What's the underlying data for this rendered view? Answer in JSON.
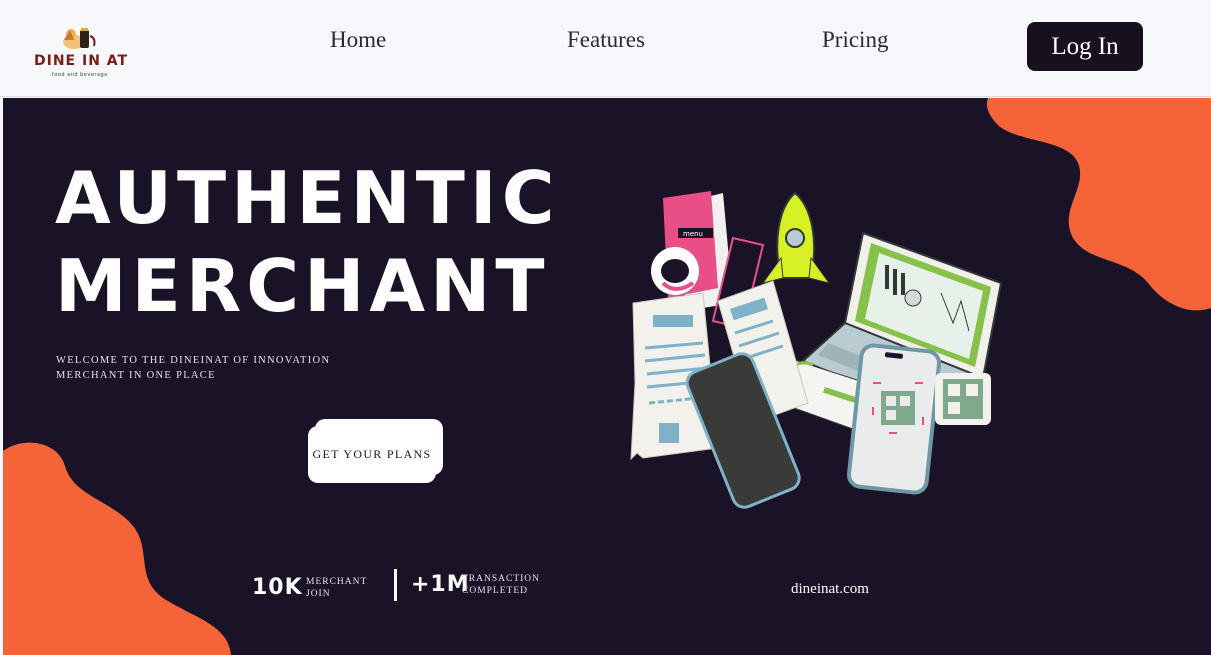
{
  "brand": {
    "name": "DINE IN AT",
    "tagline": "food and beverage"
  },
  "nav": {
    "links": [
      {
        "label": "Home"
      },
      {
        "label": "Features"
      },
      {
        "label": "Pricing"
      }
    ],
    "login_label": "Log In"
  },
  "hero": {
    "headline_line1": "AUTHENTIC",
    "headline_line2": "MERCHANT",
    "welcome_line1": "WELCOME TO THE DINEINAT OF INNOVATION",
    "welcome_line2": "MERCHANT IN ONE PLACE",
    "cta_label": "GET YOUR PLANS",
    "illustration_menu_label": "menu"
  },
  "stats": [
    {
      "value": "10K",
      "label_line1": "MERCHANT",
      "label_line2": "JOIN"
    },
    {
      "value": "+1M",
      "label_line1": "TRANSACTION",
      "label_line2": "COMPLETED"
    }
  ],
  "footer": {
    "url": "dineinat.com"
  },
  "colors": {
    "hero_bg": "#1a1226",
    "accent_orange": "#f46438",
    "nav_bg": "#f7f8fc",
    "button_dark": "#16101f"
  }
}
